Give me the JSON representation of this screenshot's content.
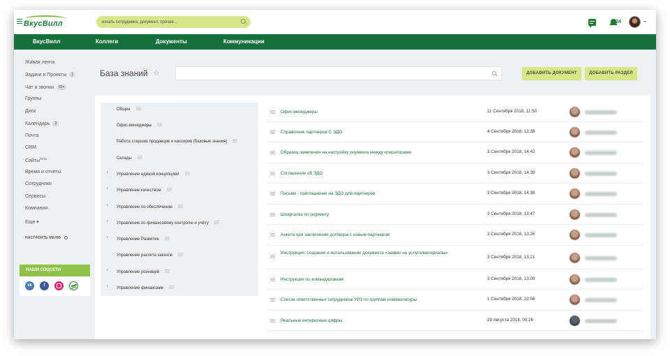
{
  "header": {
    "logo_text": "ВкусВилл",
    "search_placeholder": "искать сотрудника, документ, прочее...",
    "notifications_count": "24"
  },
  "nav": [
    "ВкусВилл",
    "Коллеги",
    "Документы",
    "Коммуникации"
  ],
  "sidebar": {
    "items": [
      {
        "label": "Живая лента"
      },
      {
        "label": "Задачи и Проекты",
        "badge": "1"
      },
      {
        "label": "Чат и звонки",
        "badge": "50+"
      },
      {
        "label": "Группы"
      },
      {
        "label": "Диск"
      },
      {
        "label": "Календарь",
        "badge": "3"
      },
      {
        "label": "Почта"
      },
      {
        "label": "CRM"
      },
      {
        "label": "Сайты",
        "sup": "beta"
      },
      {
        "label": "Время и отчеты"
      },
      {
        "label": "Сотрудники"
      },
      {
        "label": "Сервисы"
      },
      {
        "label": "Компания"
      },
      {
        "label": "Еще ▾"
      }
    ],
    "configure": "НАСТРОИТЬ МЕНЮ"
  },
  "social": {
    "title": "НАШИ СОЦСЕТИ",
    "icons": [
      "vk-icon",
      "facebook-icon",
      "instagram-icon",
      "vkusvill-icon"
    ]
  },
  "knowledge_base": {
    "title": "База знаний",
    "add_document": "ДОБАВИТЬ ДОКУМЕНТ",
    "add_section": "ДОБАВИТЬ РАЗДЕЛ"
  },
  "categories": [
    {
      "label": "Общее",
      "expandable": false
    },
    {
      "label": "Офис-менеджеры",
      "expandable": false
    },
    {
      "label": "Работа старших продавцов и кассиров (базовые знания)",
      "expandable": false
    },
    {
      "label": "Склады",
      "expandable": false
    },
    {
      "label": "Управление единой концепцией",
      "expandable": true
    },
    {
      "label": "Управление качеством",
      "expandable": true
    },
    {
      "label": "Управление по обеспечению",
      "expandable": true
    },
    {
      "label": "Управление по финансовому контролю и учёту",
      "expandable": true
    },
    {
      "label": "Управление Развитие",
      "expandable": true
    },
    {
      "label": "Управление расчета заказов",
      "expandable": false
    },
    {
      "label": "Управление розницей",
      "expandable": true
    },
    {
      "label": "Управление финансами",
      "expandable": true
    }
  ],
  "documents": [
    {
      "title": "Офис-менеджеры",
      "date": "11 Сентября 2018, 11:50"
    },
    {
      "title": "Справочник партнеров С ЭДО",
      "date": "4 Сентября 2018, 12:38"
    },
    {
      "title": "Образец заявления на настройку роуминга между операторами",
      "date": "3 Сентября 2018, 14:42"
    },
    {
      "title": "Соглашение об ЭДО",
      "date": "3 Сентября 2018, 14:39"
    },
    {
      "title": "Письмо - приглашение на ЭДО для партнеров",
      "date": "3 Сентября 2018, 14:38"
    },
    {
      "title": "Шпаргалка по роумингу",
      "date": "3 Сентября 2018, 13:47"
    },
    {
      "title": "Анкета при заключении договора с новым партнером",
      "date": "3 Сентября 2018, 13:26"
    },
    {
      "title": "Инструкция: создание и использование документа «заявки на услуги/материалы»",
      "date": "3 Сентября 2018, 13:21"
    },
    {
      "title": "Инструкция по командировкам",
      "date": "3 Сентября 2018, 13:09"
    },
    {
      "title": "Список ответственных сотрудников УРЗ по группам номенклатуры",
      "date": "1 Сентября 2018, 22:06"
    },
    {
      "title": "Реальные интересные цифры",
      "date": "29 Августа 2018, 00:26"
    }
  ]
}
